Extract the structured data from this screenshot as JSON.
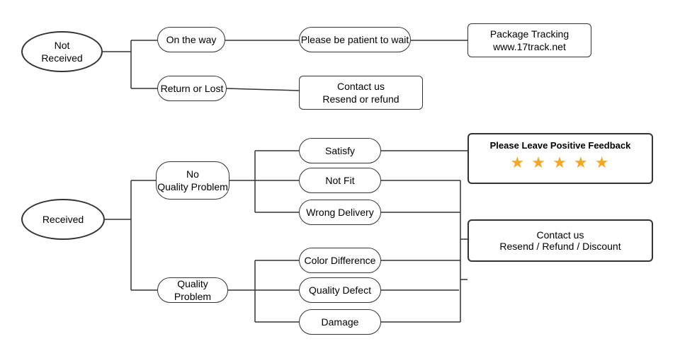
{
  "nodes": {
    "not_received": {
      "label": "Not\nReceived"
    },
    "on_the_way": {
      "label": "On the way"
    },
    "return_lost": {
      "label": "Return or Lost"
    },
    "patient": {
      "label": "Please be patient to wait"
    },
    "contact_resend_refund": {
      "label": "Contact us\nResend or refund"
    },
    "package_tracking": {
      "label": "Package Tracking\nwww.17track.net"
    },
    "received": {
      "label": "Received"
    },
    "no_quality": {
      "label": "No\nQuality Problem"
    },
    "quality_problem": {
      "label": "Quality Problem"
    },
    "satisfy": {
      "label": "Satisfy"
    },
    "not_fit": {
      "label": "Not Fit"
    },
    "wrong_delivery": {
      "label": "Wrong Delivery"
    },
    "color_diff": {
      "label": "Color Difference"
    },
    "quality_defect": {
      "label": "Quality Defect"
    },
    "damage": {
      "label": "Damage"
    },
    "feedback_title": {
      "label": "Please Leave Positive Feedback"
    },
    "contact_resend_refund2": {
      "label": "Contact us\nResend / Refund / Discount"
    },
    "stars": {
      "label": "★ ★ ★ ★ ★"
    }
  }
}
